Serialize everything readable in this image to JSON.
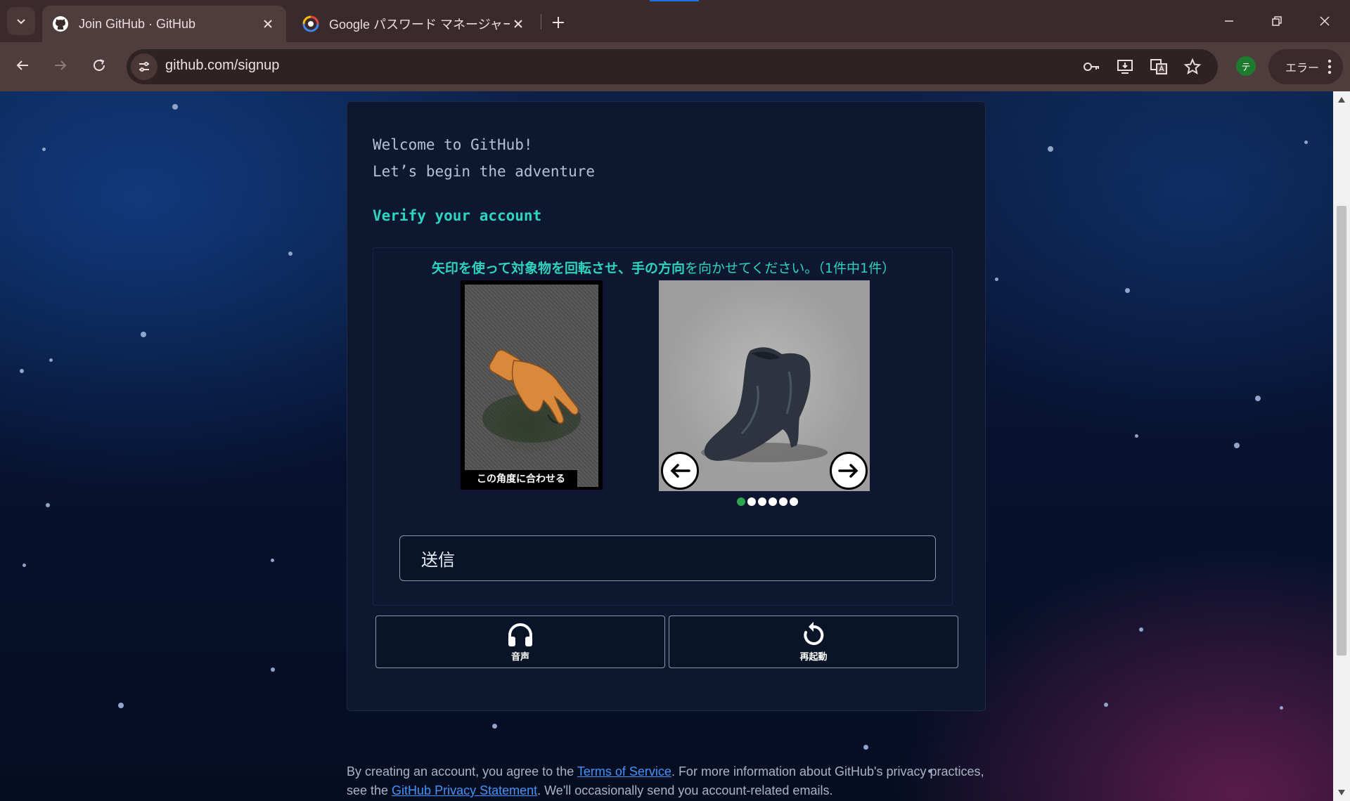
{
  "browser": {
    "tabs": [
      {
        "title": "Join GitHub · GitHub",
        "active": true,
        "favicon": "github-icon"
      },
      {
        "title": "Google パスワード マネージャー",
        "active": false,
        "favicon": "google-password-icon"
      }
    ],
    "url": "github.com/signup",
    "profile_initial": "テ",
    "error_chip_label": "エラー",
    "accent_color": "#1a73e8"
  },
  "signup": {
    "welcome_line1": "Welcome to GitHub!",
    "welcome_line2": "Let’s begin the adventure",
    "verify_title": "Verify your account",
    "captcha": {
      "prompt_bold": "矢印を使って対象物を回転させ、手の方向",
      "prompt_rest": "を向かせてください。（1件中1件）",
      "reference_caption": "この角度に合わせる",
      "dots_total": 6,
      "dots_active_index": 0,
      "submit_label": "送信",
      "audio_label": "音声",
      "restart_label": "再起動"
    }
  },
  "footer": {
    "text_1": "By creating an account, you agree to the ",
    "tos_link": "Terms of Service",
    "text_2": ". For more information about GitHub's privacy practices, see the ",
    "privacy_link": "GitHub Privacy Statement",
    "text_3": ". We'll occasionally send you account-related emails."
  },
  "colors": {
    "teal_accent": "#2dd4bf",
    "link_blue": "#4493f8",
    "active_dot": "#2ea44f"
  }
}
